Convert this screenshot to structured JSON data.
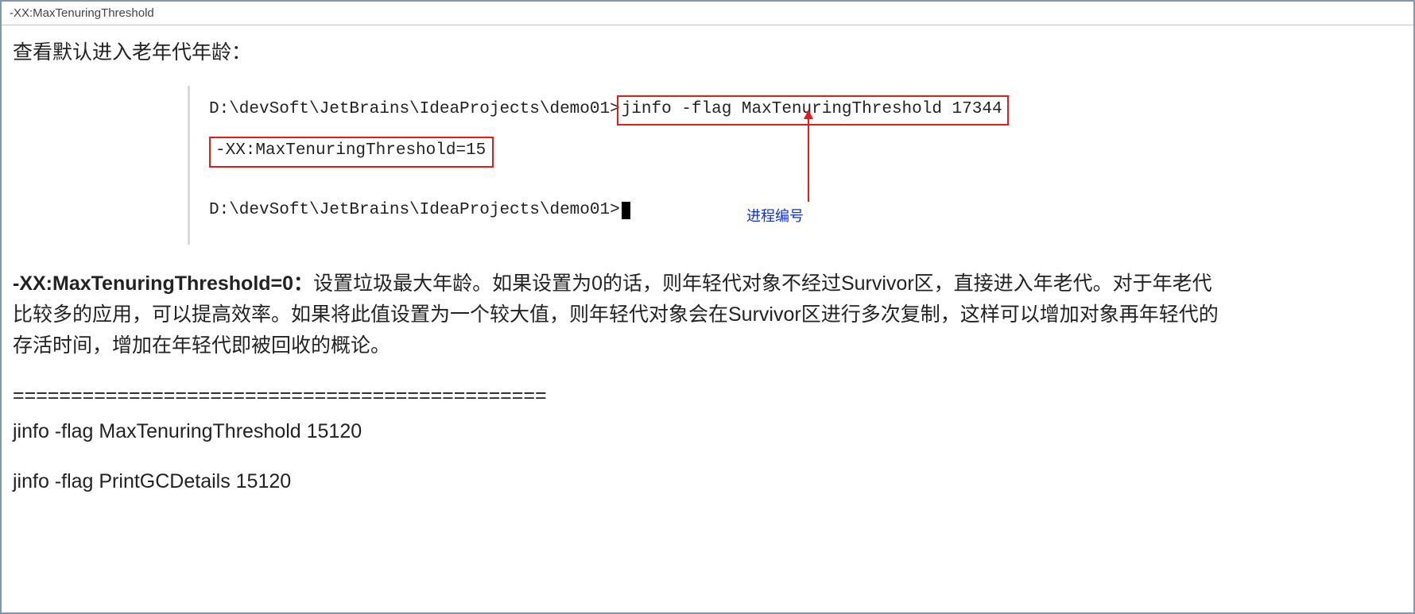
{
  "header": {
    "flag_text": "-XX:MaxTenuringThreshold"
  },
  "section": {
    "heading": "查看默认进入老年代年龄："
  },
  "terminal": {
    "prompt_path": "D:\\devSoft\\JetBrains\\IdeaProjects\\demo01>",
    "command_1": "jinfo -flag MaxTenuringThreshold 17344",
    "output_1": "-XX:MaxTenuringThreshold=15",
    "prompt_path_2": "D:\\devSoft\\JetBrains\\IdeaProjects\\demo01>",
    "annotation_label": "进程编号"
  },
  "explain": {
    "bold_lead": "-XX:MaxTenuringThreshold=0：",
    "body": "设置垃圾最大年龄。如果设置为0的话，则年轻代对象不经过Survivor区，直接进入年老代。对于年老代比较多的应用，可以提高效率。如果将此值设置为一个较大值，则年轻代对象会在Survivor区进行多次复制，这样可以增加对象再年轻代的存活时间，增加在年轻代即被回收的概论。"
  },
  "divider": "==============================================",
  "commands": {
    "cmd1": "jinfo -flag MaxTenuringThreshold 15120",
    "cmd2": "jinfo -flag PrintGCDetails 15120"
  }
}
